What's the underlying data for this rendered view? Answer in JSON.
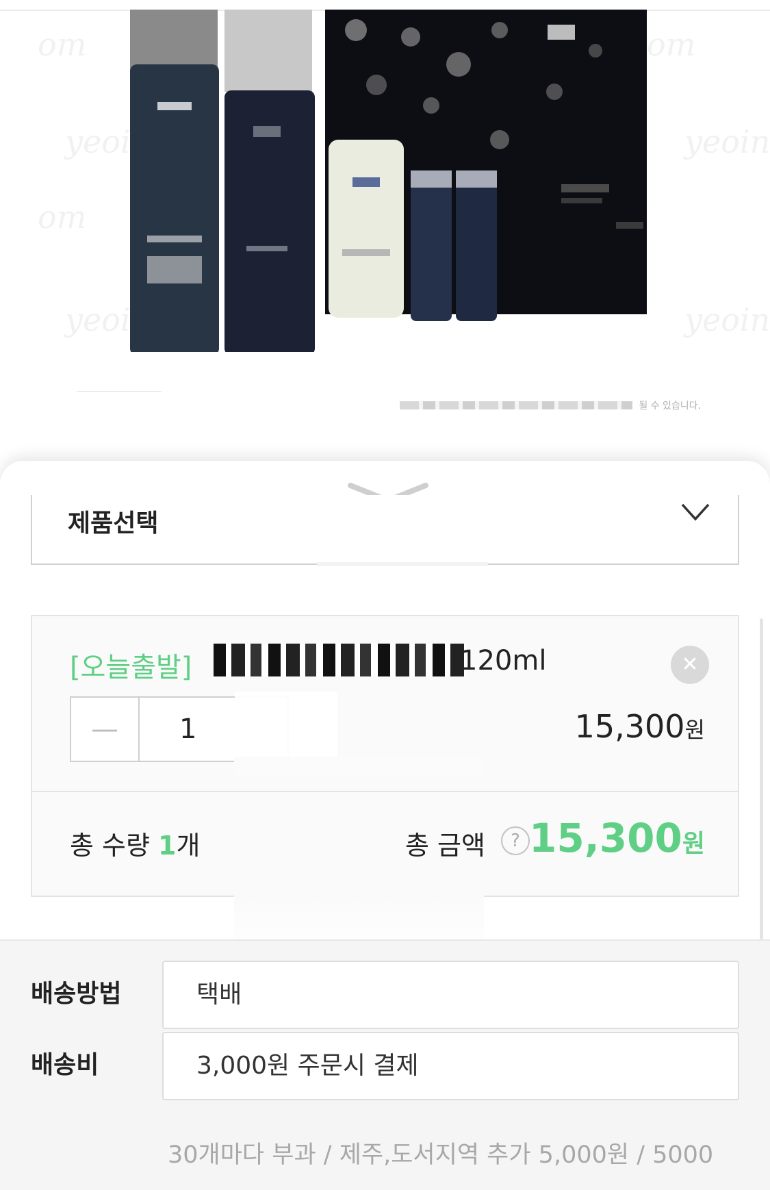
{
  "product": {
    "watermark": "yeoin",
    "watermark_alt": "om",
    "notice_tail": "될 수 있습니다."
  },
  "option_select": {
    "label": "제품선택"
  },
  "selected_option": {
    "tag": "[오늘출발]",
    "name_suffix": "120ml",
    "quantity": "1",
    "price_value": "15,300",
    "price_unit": "원",
    "decrease_symbol": "—",
    "remove_symbol": "✕"
  },
  "totals": {
    "qty_label": "총 수량 ",
    "qty_value": "1",
    "qty_unit": "개",
    "amount_label": "총 금액",
    "help_symbol": "?",
    "amount_value": "15,300",
    "amount_unit": "원"
  },
  "delivery": {
    "method_label": "배송방법",
    "method_value": "택배",
    "fee_label": "배송비",
    "fee_value": "3,000원 주문시 결제",
    "note": "30개마다 부과 / 제주,도서지역 추가 5,000원 / 5000"
  },
  "colors": {
    "accent_green": "#5ecf84",
    "border_gray": "#dddddd",
    "section_bg": "#f5f5f5"
  }
}
